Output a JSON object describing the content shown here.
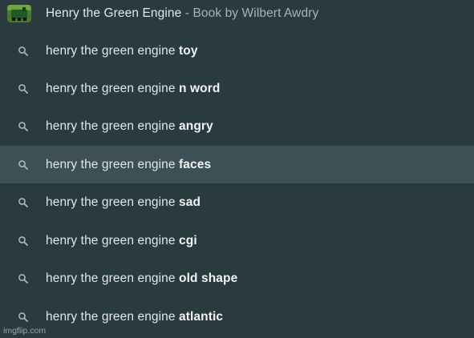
{
  "top_suggestion": {
    "title": "Henry the Green Engine",
    "separator": " - ",
    "description": "Book by Wilbert Awdry",
    "thumbnail_icon": "book-cover-thumbnail"
  },
  "suggestions": [
    {
      "prefix": "henry the green engine ",
      "completion": "toy"
    },
    {
      "prefix": "henry the green engine ",
      "completion": "n word"
    },
    {
      "prefix": "henry the green engine ",
      "completion": "angry"
    },
    {
      "prefix": "henry the green engine ",
      "completion": "faces"
    },
    {
      "prefix": "henry the green engine ",
      "completion": "sad"
    },
    {
      "prefix": "henry the green engine ",
      "completion": "cgi"
    },
    {
      "prefix": "henry the green engine ",
      "completion": "old shape"
    },
    {
      "prefix": "henry the green engine ",
      "completion": "atlantic"
    }
  ],
  "selected_index": 3,
  "suggestion_icon": "search-icon",
  "watermark": "imgflip.com",
  "colors": {
    "background": "#2a3b40",
    "selected_row": "#3c5055",
    "text": "#e3e7e7",
    "secondary_text": "#aab3b4"
  }
}
